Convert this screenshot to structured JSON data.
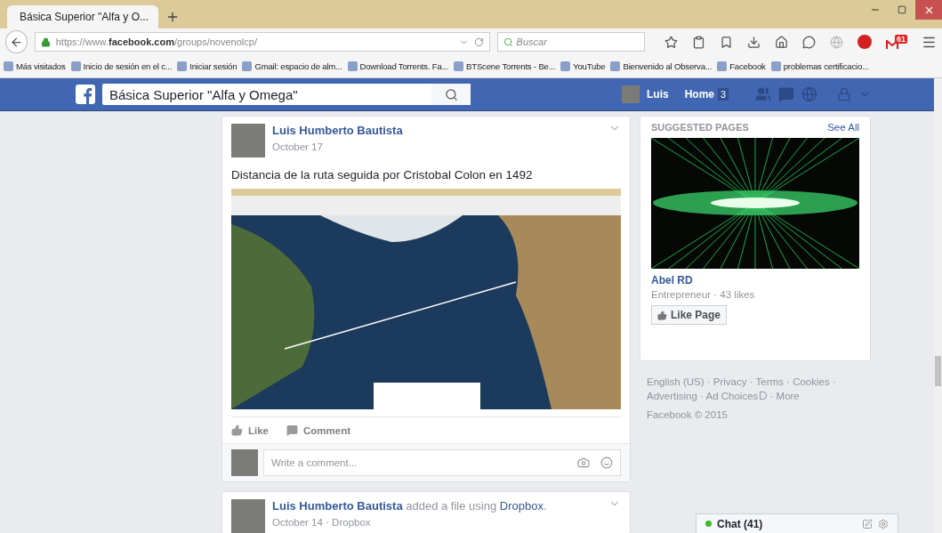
{
  "browser": {
    "tab_title": "Básica Superior \"Alfa y O...",
    "url_host": "https://www.",
    "url_domain": "facebook.com",
    "url_path": "/groups/novenolcp/",
    "search_placeholder": "Buscar",
    "mail_badge": "61"
  },
  "bookmarks": [
    "Más visitados",
    "Inicio de sesión en el c...",
    "Iniciar sesión",
    "Gmail: espacio de alm...",
    "Download Torrents. Fa...",
    "BTScene Torrents - Be...",
    "YouTube",
    "Bienvenido al Observa...",
    "Facebook",
    "problemas certificacio..."
  ],
  "header": {
    "search_value": "Básica Superior \"Alfa y Omega\"",
    "user": "Luis",
    "home": "Home",
    "home_count": "3"
  },
  "posts": [
    {
      "author": "Luis Humberto Bautista",
      "meta": "October 17",
      "text": "Distancia de la ruta seguida por Cristobal Colon en 1492",
      "has_image": true,
      "actions": [
        "Like",
        "Comment"
      ],
      "comment_placeholder": "Write a comment..."
    },
    {
      "author": "Luis Humberto Bautista",
      "action": "added a file using",
      "action_link": "Dropbox",
      "action_end": ".",
      "meta": "October 14 · Dropbox",
      "has_image": false
    }
  ],
  "suggested": {
    "title": "SUGGESTED PAGES",
    "see_all": "See All",
    "page_name": "Abel RD",
    "page_meta": "Entrepreneur · 43 likes",
    "like_button": "Like Page"
  },
  "footer": {
    "links": [
      "English (US)",
      "Privacy",
      "Terms",
      "Cookies",
      "Advertising",
      "Ad Choices",
      "More"
    ],
    "separator": "·",
    "copyright": "Facebook © 2015"
  },
  "chat": {
    "label": "Chat (41)",
    "online": true
  }
}
